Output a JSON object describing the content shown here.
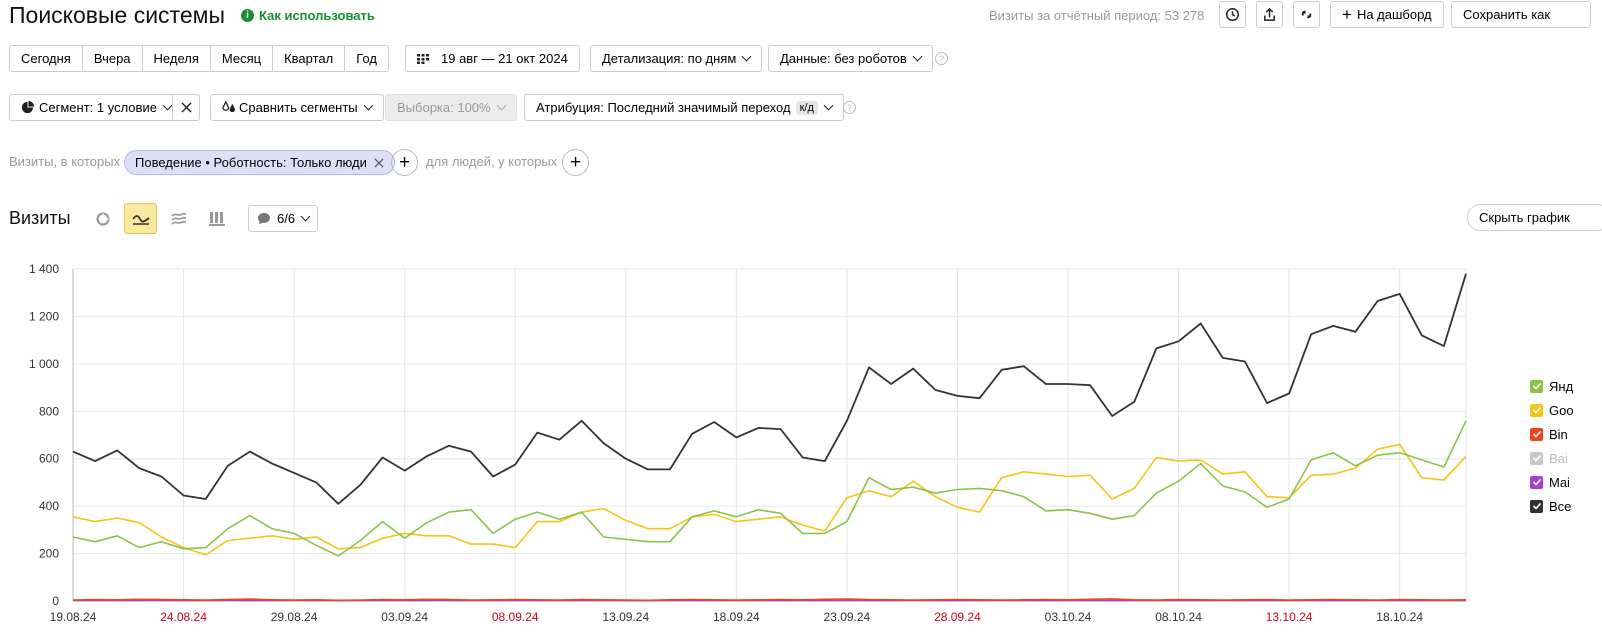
{
  "header": {
    "title": "Поисковые системы",
    "howto": "Как использовать",
    "visits_total": "Визиты за отчётный период: 53 278",
    "to_dashboard": "На дашборд",
    "save_as": "Сохранить как"
  },
  "periods": [
    "Сегодня",
    "Вчера",
    "Неделя",
    "Месяц",
    "Квартал",
    "Год"
  ],
  "date_range": "19 авг — 21 окт 2024",
  "detail": "Детализация: по дням",
  "data_filter": "Данные: без роботов",
  "help_mark": "?",
  "segment": {
    "label": "Сегмент: 1 условие"
  },
  "compare": "Сравнить сегменты",
  "sampling": "Выборка: 100%",
  "attribution": {
    "label": "Атрибуция: Последний значимый переход",
    "badge": "к/д"
  },
  "filter": {
    "prefix": "Визиты, в которых",
    "condition": "Поведение • Роботность: Только люди",
    "people": "для людей, у которых"
  },
  "chart_header": {
    "title": "Визиты",
    "annotations": "6/6",
    "hide_chart": "Скрыть график"
  },
  "legend": [
    {
      "name": "Янд",
      "color": "#8bc34a",
      "checked": true
    },
    {
      "name": "Goo",
      "color": "#f5c518",
      "checked": true
    },
    {
      "name": "Bin",
      "color": "#f0441e",
      "checked": true
    },
    {
      "name": "Bai",
      "color": "#c8c8c8",
      "checked": true
    },
    {
      "name": "Mai",
      "color": "#a63fc9",
      "checked": true
    },
    {
      "name": "Все",
      "color": "#333333",
      "checked": true
    }
  ],
  "chart_data": {
    "type": "line",
    "x": [
      "19.08.24",
      "20.08.24",
      "21.08.24",
      "22.08.24",
      "23.08.24",
      "24.08.24",
      "25.08.24",
      "26.08.24",
      "27.08.24",
      "28.08.24",
      "29.08.24",
      "30.08.24",
      "31.08.24",
      "01.09.24",
      "02.09.24",
      "03.09.24",
      "04.09.24",
      "05.09.24",
      "06.09.24",
      "07.09.24",
      "08.09.24",
      "09.09.24",
      "10.09.24",
      "11.09.24",
      "12.09.24",
      "13.09.24",
      "14.09.24",
      "15.09.24",
      "16.09.24",
      "17.09.24",
      "18.09.24",
      "19.09.24",
      "20.09.24",
      "21.09.24",
      "22.09.24",
      "23.09.24",
      "24.09.24",
      "25.09.24",
      "26.09.24",
      "27.09.24",
      "28.09.24",
      "29.09.24",
      "30.09.24",
      "01.10.24",
      "02.10.24",
      "03.10.24",
      "04.10.24",
      "05.10.24",
      "06.10.24",
      "07.10.24",
      "08.10.24",
      "09.10.24",
      "10.10.24",
      "11.10.24",
      "12.10.24",
      "13.10.24",
      "14.10.24",
      "15.10.24",
      "16.10.24",
      "17.10.24",
      "18.10.24",
      "19.10.24",
      "20.10.24",
      "21.10.24"
    ],
    "x_tick_labels": [
      "19.08.24",
      "24.08.24",
      "29.08.24",
      "03.09.24",
      "08.09.24",
      "13.09.24",
      "18.09.24",
      "23.09.24",
      "28.09.24",
      "03.10.24",
      "08.10.24",
      "13.10.24",
      "18.10.24"
    ],
    "x_tick_weekend": [
      false,
      true,
      false,
      false,
      true,
      false,
      false,
      false,
      true,
      false,
      false,
      true,
      false
    ],
    "ylim": [
      0,
      1400
    ],
    "yticks": [
      "0",
      "200",
      "400",
      "600",
      "800",
      "1 000",
      "1 200",
      "1 400"
    ],
    "ytick_values": [
      0,
      200,
      400,
      600,
      800,
      1000,
      1200,
      1400
    ],
    "grid": true,
    "series": [
      {
        "name": "Все",
        "color": "#333333",
        "values": [
          630,
          590,
          635,
          560,
          525,
          445,
          430,
          570,
          630,
          580,
          540,
          500,
          410,
          490,
          605,
          550,
          610,
          655,
          630,
          525,
          575,
          710,
          680,
          760,
          665,
          600,
          555,
          555,
          705,
          755,
          690,
          730,
          725,
          605,
          590,
          760,
          985,
          915,
          980,
          890,
          865,
          855,
          975,
          990,
          915,
          915,
          910,
          780,
          840,
          1065,
          1095,
          1170,
          1025,
          1010,
          835,
          875,
          1125,
          1160,
          1135,
          1265,
          1295,
          1120,
          1075,
          1380
        ]
      },
      {
        "name": "Янд",
        "color": "#8bc34a",
        "values": [
          270,
          250,
          275,
          225,
          250,
          220,
          225,
          305,
          360,
          305,
          285,
          235,
          190,
          255,
          335,
          265,
          330,
          375,
          385,
          285,
          345,
          375,
          345,
          375,
          270,
          260,
          250,
          250,
          355,
          380,
          355,
          385,
          370,
          285,
          285,
          335,
          520,
          470,
          480,
          455,
          470,
          475,
          465,
          440,
          380,
          385,
          370,
          345,
          360,
          455,
          505,
          580,
          485,
          460,
          395,
          430,
          595,
          625,
          570,
          615,
          625,
          595,
          565,
          760
        ]
      },
      {
        "name": "Goo",
        "color": "#f5c518",
        "values": [
          355,
          335,
          350,
          330,
          270,
          225,
          195,
          255,
          265,
          275,
          260,
          270,
          220,
          225,
          265,
          285,
          275,
          275,
          240,
          240,
          225,
          335,
          335,
          375,
          390,
          340,
          305,
          305,
          355,
          365,
          335,
          345,
          355,
          320,
          295,
          435,
          465,
          440,
          505,
          440,
          395,
          375,
          520,
          545,
          535,
          525,
          530,
          430,
          475,
          605,
          590,
          595,
          535,
          545,
          440,
          435,
          530,
          535,
          560,
          640,
          660,
          520,
          510,
          610
        ]
      },
      {
        "name": "Bin",
        "color": "#f0441e",
        "values": [
          4,
          6,
          5,
          7,
          6,
          5,
          4,
          6,
          8,
          5,
          4,
          5,
          3,
          4,
          6,
          5,
          7,
          6,
          4,
          5,
          6,
          5,
          4,
          6,
          5,
          4,
          3,
          5,
          6,
          5,
          4,
          5,
          6,
          5,
          7,
          8,
          6,
          5,
          4,
          5,
          6,
          5,
          4,
          5,
          6,
          5,
          7,
          9,
          5,
          4,
          6,
          5,
          4,
          5,
          6,
          4,
          5,
          6,
          5,
          4,
          6,
          5,
          4,
          5
        ]
      },
      {
        "name": "Mai",
        "color": "#a63fc9",
        "values": [
          2,
          2,
          3,
          2,
          3,
          2,
          2,
          3,
          2,
          2,
          3,
          2,
          2,
          2,
          3,
          2,
          2,
          3,
          2,
          2,
          3,
          2,
          2,
          2,
          3,
          2,
          2,
          2,
          3,
          2,
          2,
          3,
          2,
          2,
          2,
          3,
          2,
          2,
          3,
          2,
          2,
          2,
          3,
          2,
          2,
          3,
          2,
          2,
          2,
          3,
          2,
          2,
          3,
          2,
          2,
          2,
          3,
          2,
          2,
          3,
          2,
          2,
          3,
          2
        ]
      },
      {
        "name": "Bai",
        "color": "#c8c8c8",
        "values": [
          1,
          1,
          1,
          1,
          1,
          1,
          1,
          1,
          1,
          1,
          1,
          1,
          1,
          1,
          1,
          1,
          1,
          1,
          1,
          1,
          1,
          1,
          1,
          1,
          1,
          1,
          1,
          1,
          1,
          1,
          1,
          1,
          1,
          1,
          1,
          1,
          1,
          1,
          1,
          1,
          1,
          1,
          1,
          1,
          1,
          1,
          1,
          1,
          1,
          1,
          1,
          1,
          1,
          1,
          1,
          1,
          1,
          1,
          1,
          1,
          1,
          1,
          1,
          1
        ]
      }
    ]
  }
}
